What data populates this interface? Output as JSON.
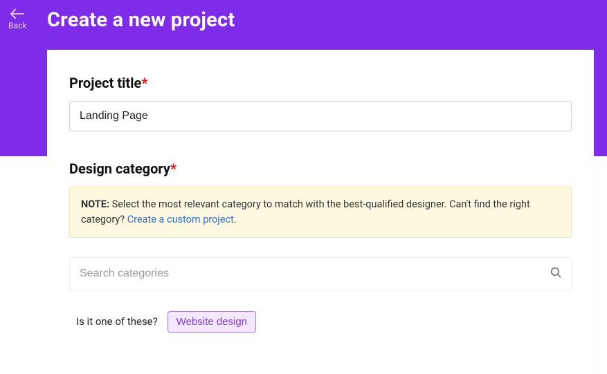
{
  "header": {
    "back_label": "Back",
    "page_title": "Create a new project"
  },
  "project_title": {
    "label": "Project title",
    "value": "Landing Page"
  },
  "design_category": {
    "label": "Design category",
    "note_label": "NOTE:",
    "note_text": " Select the most relevant category to match with the best-qualified designer. Can't find the right category? ",
    "note_link": "Create a custom project",
    "note_suffix": ".",
    "search_placeholder": "Search categories",
    "suggest_label": "Is it one of these?",
    "suggestions": [
      "Website design"
    ]
  }
}
